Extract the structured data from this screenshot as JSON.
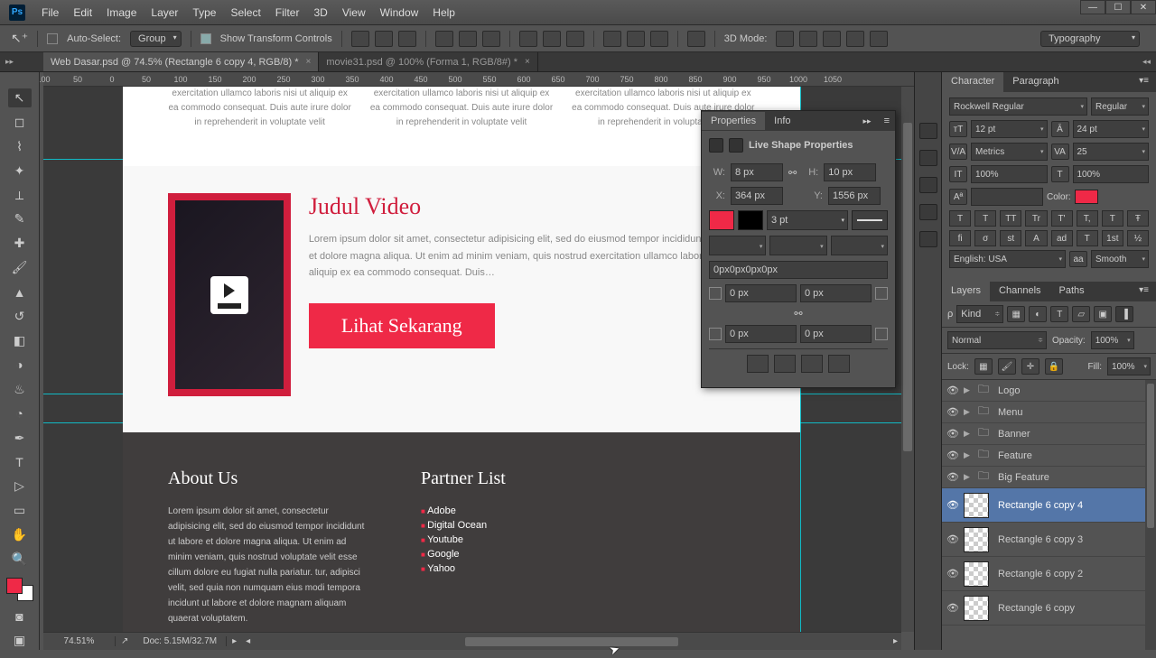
{
  "menubar": [
    "File",
    "Edit",
    "Image",
    "Layer",
    "Type",
    "Select",
    "Filter",
    "3D",
    "View",
    "Window",
    "Help"
  ],
  "optionsbar": {
    "auto_select": "Auto-Select:",
    "group": "Group",
    "show_transform": "Show Transform Controls",
    "mode_3d": "3D Mode:",
    "workspace": "Typography"
  },
  "tabs": [
    {
      "label": "Web Dasar.psd @ 74.5% (Rectangle 6 copy 4, RGB/8) *",
      "active": true
    },
    {
      "label": "movie31.psd @ 100% (Forma 1, RGB/8#) *",
      "active": false
    }
  ],
  "ruler_marks": [
    "100",
    "50",
    "0",
    "50",
    "100",
    "150",
    "200",
    "250",
    "300",
    "350",
    "400",
    "450",
    "500",
    "550",
    "600",
    "650",
    "700",
    "750",
    "800",
    "850",
    "900",
    "950",
    "1000",
    "1050"
  ],
  "canvas": {
    "feature_text": "exercitation ullamco laboris nisi ut aliquip ex ea commodo consequat. Duis aute irure dolor in reprehenderit in voluptate velit",
    "video_title": "Judul Video",
    "video_body": "Lorem ipsum dolor sit amet, consectetur adipisicing elit, sed do eiusmod tempor incididunt ut labore et dolore magna aliqua. Ut enim ad minim veniam, quis nostrud exercitation ullamco laboris nisi ut aliquip ex ea commodo consequat. Duis…",
    "cta": "Lihat Sekarang",
    "about_h": "About Us",
    "about_body": "Lorem ipsum dolor sit amet, consectetur adipisicing elit, sed do eiusmod tempor incididunt ut labore et dolore magna aliqua. Ut enim ad minim veniam, quis nostrud voluptate velit esse cillum dolore eu fugiat nulla pariatur. tur, adipisci velit, sed quia non numquam eius modi tempora incidunt ut labore et dolore magnam aliquam quaerat voluptatem.",
    "partner_h": "Partner List",
    "partners": [
      "Adobe",
      "Digital Ocean",
      "Youtube",
      "Google",
      "Yahoo"
    ]
  },
  "status": {
    "zoom": "74.51%",
    "doc": "Doc: 5.15M/32.7M"
  },
  "properties": {
    "tab1": "Properties",
    "tab2": "Info",
    "title": "Live Shape Properties",
    "w_lbl": "W:",
    "w": "8 px",
    "h_lbl": "H:",
    "h": "10 px",
    "x_lbl": "X:",
    "x": "364 px",
    "y_lbl": "Y:",
    "y": "1556 px",
    "stroke": "3 pt",
    "radius_all": "0px0px0px0px",
    "corner": "0 px"
  },
  "character": {
    "tab1": "Character",
    "tab2": "Paragraph",
    "font": "Rockwell Regular",
    "style": "Regular",
    "size": "12 pt",
    "leading": "24 pt",
    "kerning": "Metrics",
    "tracking": "25",
    "vscale": "100%",
    "hscale": "100%",
    "color_lbl": "Color:",
    "styles": [
      "T",
      "T",
      "TT",
      "Tr",
      "T'",
      "T,",
      "T",
      "Ŧ"
    ],
    "opentype": [
      "fi",
      "σ",
      "st",
      "A",
      "ad",
      "T",
      "1st",
      "½"
    ],
    "lang": "English: USA",
    "aa": "Smooth"
  },
  "layers": {
    "tab1": "Layers",
    "tab2": "Channels",
    "tab3": "Paths",
    "kind": "Kind",
    "blend": "Normal",
    "opacity_lbl": "Opacity:",
    "opacity": "100%",
    "lock_lbl": "Lock:",
    "fill_lbl": "Fill:",
    "fill": "100%",
    "items": [
      {
        "name": "Logo",
        "type": "folder"
      },
      {
        "name": "Menu",
        "type": "folder"
      },
      {
        "name": "Banner",
        "type": "folder"
      },
      {
        "name": "Feature",
        "type": "folder"
      },
      {
        "name": "Big Feature",
        "type": "folder"
      },
      {
        "name": "Rectangle 6 copy 4",
        "type": "shape",
        "selected": true
      },
      {
        "name": "Rectangle 6 copy 3",
        "type": "shape"
      },
      {
        "name": "Rectangle 6 copy 2",
        "type": "shape"
      },
      {
        "name": "Rectangle 6 copy",
        "type": "shape"
      }
    ]
  }
}
